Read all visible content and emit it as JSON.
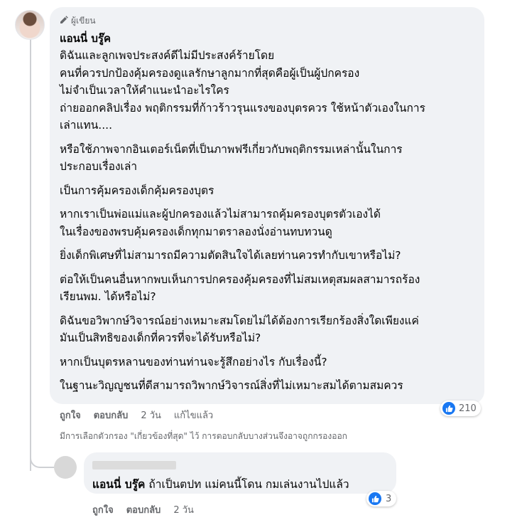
{
  "main_comment": {
    "badge": "ผู้เขียน",
    "author": "แอนนี่ บรู๊ค",
    "paragraphs": [
      "ดิฉันและลูกเพจประสงค์ดีไม่มีประสงค์ร้ายโดย\nคนที่ควรปกป้องคุ้มครองดูแลรักษาลูกมากที่สุดคือผู้เป็นผู้ปกครอง\nไม่จำเป็นเวลาให้คำแนะนำอะไรใคร\nถ่ายออกคลิปเรื่อง พฤติกรรมที่ก้าวร้าวรุนแรงของบุตรควร ใช้หน้าตัวเองในการ\nเล่าแทน....",
      "หรือใช้ภาพจากอินเตอร์เน็ตที่เป็นภาพฟรีเกี่ยวกับพฤติกรรมเหล่านั้นในการ\nประกอบเรื่องเล่า",
      "เป็นการคุ้มครองเด็กคุ้มครองบุตร",
      "หากเราเป็นพ่อแม่และผู้ปกครองแล้วไม่สามารถคุ้มครองบุตรตัวเองได้\nในเรื่องของพรบคุ้มครองเด็กทุกมาตราลองนั่งอ่านทบทวนดู",
      "ยิ่งเด็กพิเศษที่ไม่สามารถมีความตัดสินใจได้เลยท่านควรทำกับเขาหรือไม่?",
      "ต่อให้เป็นคนอื่นหากพบเห็นการปกครองคุ้มครองที่ไม่สมเหตุสมผลสามารถร้อง\nเรียนพม. ได้หรือไม่?",
      "ดิฉันขอวิพากษ์วิจารณ์อย่างเหมาะสมโดยไม่ได้ต้องการเรียกร้องสิ่งใดเพียงแค่\nมันเป็นสิทธิของเด็กที่ควรที่จะได้รับหรือไม่?",
      "หากเป็นบุตรหลานของท่านท่านจะรู้สึกอย่างไร กับเรื่องนี้?",
      "ในฐานะวิญญูชนที่ดีสามารถวิพากษ์วิจารณ์สิ่งที่ไม่เหมาะสมได้ตามสมควร"
    ],
    "actions": {
      "like": "ถูกใจ",
      "reply": "ตอบกลับ",
      "time": "2 วัน",
      "edited": "แก้ไขแล้ว"
    },
    "reaction_count": "210",
    "filter_note": "มีการเลือกตัวกรอง \"เกี่ยวข้องที่สุด\" ไว้ การตอบกลับบางส่วนจึงอาจถูกกรองออก"
  },
  "reply_comment": {
    "mention": "แอนนี่ บรู๊ค",
    "text": "ถ้าเป็นตปท แม่คนนี้โดน กมเล่นงานไปแล้ว",
    "reaction_count": "3",
    "actions": {
      "like": "ถูกใจ",
      "reply": "ตอบกลับ",
      "time": "2 วัน"
    }
  },
  "colors": {
    "like_blue": "#1877f2",
    "bubble": "#f0f2f5",
    "meta_gray": "#65676b"
  }
}
